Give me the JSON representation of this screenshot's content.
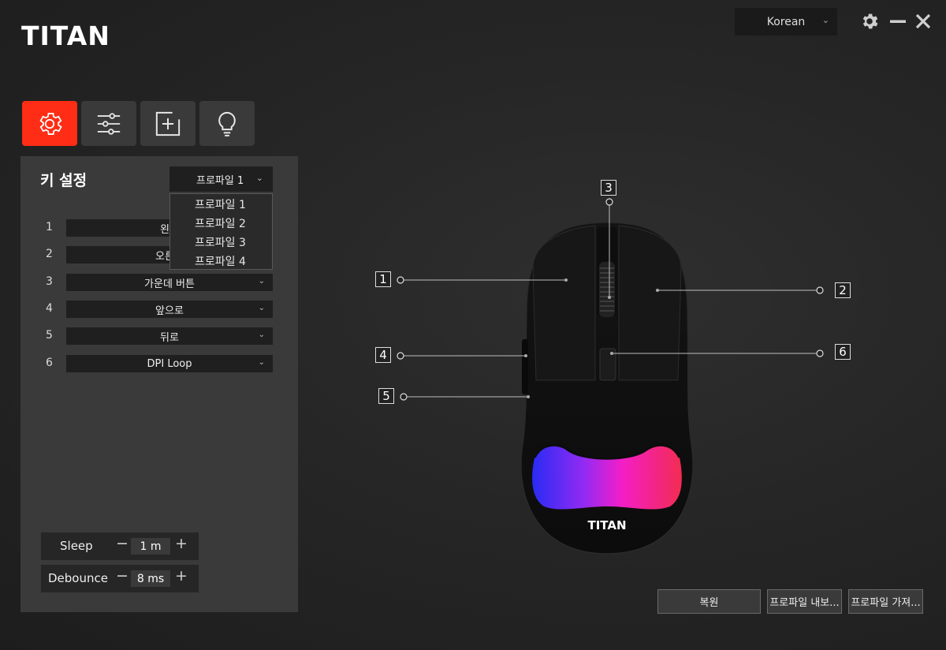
{
  "app": {
    "logo": "TITAN"
  },
  "header": {
    "language": "Korean"
  },
  "panel": {
    "title": "키 설정",
    "profile_selected": "프로파일 1",
    "profile_options": [
      "프로파일 1",
      "프로파일 2",
      "프로파일 3",
      "프로파일 4"
    ],
    "keys": [
      {
        "num": "1",
        "value": "왼쪽"
      },
      {
        "num": "2",
        "value": "오른쪽"
      },
      {
        "num": "3",
        "value": "가운데 버튼"
      },
      {
        "num": "4",
        "value": "앞으로"
      },
      {
        "num": "5",
        "value": "뒤로"
      },
      {
        "num": "6",
        "value": "DPI Loop"
      }
    ],
    "sleep": {
      "label": "Sleep",
      "value": "1 m"
    },
    "debounce": {
      "label": "Debounce",
      "value": "8 ms"
    }
  },
  "mouse": {
    "logo": "TITAN",
    "callouts": [
      "1",
      "2",
      "3",
      "4",
      "5",
      "6"
    ]
  },
  "buttons": {
    "restore": "복원",
    "export": "프로파일 내보...",
    "import": "프로파일 가져..."
  },
  "colors": {
    "accent": "#ff2d15",
    "panel": "#3a3a3a"
  },
  "icons": [
    "gear-icon",
    "sliders-icon",
    "plus-square-icon",
    "lightbulb-icon",
    "settings-gear-icon",
    "minimize-icon",
    "close-icon"
  ]
}
